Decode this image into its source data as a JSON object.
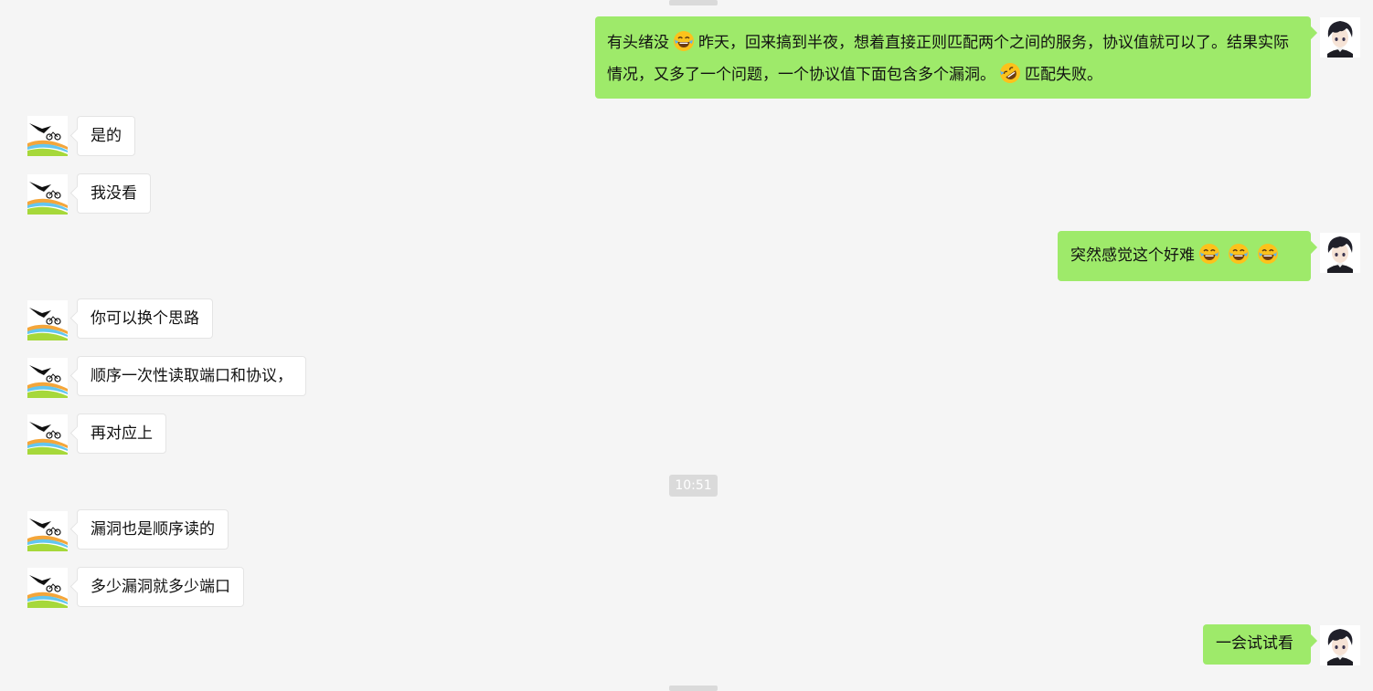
{
  "timestamp": "10:51",
  "messages": [
    {
      "side": "right",
      "parts": [
        "有头绪没",
        "emoji:tears-of-joy",
        "昨天，回来搞到半夜，想着直接正则匹配两个之间的服务，协议值就可以了。结果实际情况，又多了一个问题，一个协议值下面包含多个漏洞。",
        "emoji:rolling-laughing",
        "匹配失败。"
      ]
    },
    {
      "side": "left",
      "text": "是的"
    },
    {
      "side": "left",
      "text": "我没看"
    },
    {
      "side": "right",
      "parts": [
        "突然感觉这个好难",
        "emoji:tears-of-joy",
        "emoji:tears-of-joy",
        "emoji:tears-of-joy"
      ]
    },
    {
      "side": "left",
      "text": "你可以换个思路"
    },
    {
      "side": "left",
      "text": "顺序一次性读取端口和协议，"
    },
    {
      "side": "left",
      "text": "再对应上"
    },
    {
      "side": "left",
      "text": "漏洞也是顺序读的"
    },
    {
      "side": "left",
      "text": "多少漏洞就多少端口"
    },
    {
      "side": "right",
      "text": "一会试试看"
    }
  ],
  "avatars": {
    "self": "anime-boy-avatar",
    "other": "cyclist-avatar"
  },
  "colors": {
    "background": "#f5f5f5",
    "self_bubble": "#9eea6a",
    "other_bubble": "#ffffff",
    "timestamp_badge": "#dadada"
  }
}
